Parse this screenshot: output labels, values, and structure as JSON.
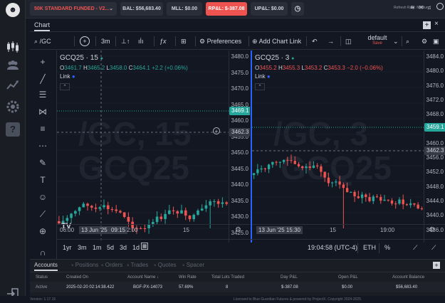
{
  "topbar": {
    "account_select": "50K STANDARD FUNDED - V2...",
    "bal": "BAL: $56,683.40",
    "mll": "MLL: $0.00",
    "rpl": "RP&L: $-387.08",
    "upl": "UP&L: $0.00",
    "refresh": "Refresh Rate: Medium"
  },
  "panel": {
    "tab": "Chart"
  },
  "toolbar": {
    "symbol": "/GC",
    "interval": "3m",
    "preferences": "Preferences",
    "add_chart_link": "Add Chart Link",
    "layout": "default",
    "layout_sub": "Save"
  },
  "chart1": {
    "title": "GCQ25 · 15",
    "o": "3461.7",
    "h": "3465.2",
    "l": "3458.0",
    "c": "3464.1",
    "chg": "+2.2 (+0.06%)",
    "link": "Link",
    "watermark1": "/GC, 15",
    "watermark2": "GCQ25",
    "price_tag": "3469.1",
    "cross_tag": "3462.3",
    "yticks": [
      "3480.0",
      "3475.0",
      "3470.0",
      "3465.0",
      "3460.0",
      "3455.0",
      "3450.0",
      "3445.0",
      "3440.0",
      "3435.0",
      "3430.0",
      "3425.0"
    ],
    "xticks": [
      "06:00",
      "2:00",
      "15"
    ],
    "x_highlight1": "13 Jun '25",
    "x_highlight2": "09:15"
  },
  "chart2": {
    "title": "GCQ25 · 3",
    "o": "3455.2",
    "h": "3455.3",
    "l": "3453.2",
    "c": "3453.3",
    "chg": "−2.0 (−0.06%)",
    "link": "Link",
    "watermark1": "/GC, 3",
    "watermark2": "GCQ25",
    "price_tag": "3459.1",
    "cross_tag": "3462.3",
    "yticks": [
      "3484.0",
      "3480.0",
      "3476.0",
      "3472.0",
      "3468.0",
      "3464.0",
      "3460.0",
      "3456.0",
      "3452.0",
      "3448.0",
      "3444.0",
      "3440.0",
      "3436.0"
    ],
    "xticks": [
      "15",
      "19:00"
    ],
    "x_highlight": "13 Jun '25   15:30"
  },
  "bottom": {
    "ranges": [
      "1yr",
      "3m",
      "1m",
      "5d",
      "3d",
      "1d"
    ],
    "clock": "19:04:58 (UTC-4)",
    "session": "ETH",
    "pct": "%"
  },
  "accounts": {
    "tabs": [
      "Accounts",
      "Positions",
      "Orders",
      "Trades",
      "Quotes",
      "Spacer"
    ],
    "headers": [
      "Status",
      "Created On",
      "Account Name",
      "Win Rate",
      "Total Lots Traded",
      "Day P&L",
      "Open P&L",
      "Account Balance"
    ],
    "row": [
      "Active",
      "2025-02-20 02:14:38.422",
      "BGF-PX-14073",
      "57.69%",
      "8",
      "$-387.08",
      "$0.00",
      "$56,683.40"
    ]
  },
  "footer": {
    "version": "Version: 1.17.16",
    "license": "Licensed to Blue Guardian Futures & powered by ProjectX. Copyright 2024-2025"
  },
  "colors": {
    "up": "#26a69a",
    "down": "#ef5350",
    "accent": "#2962ff",
    "bg": "#131722"
  }
}
